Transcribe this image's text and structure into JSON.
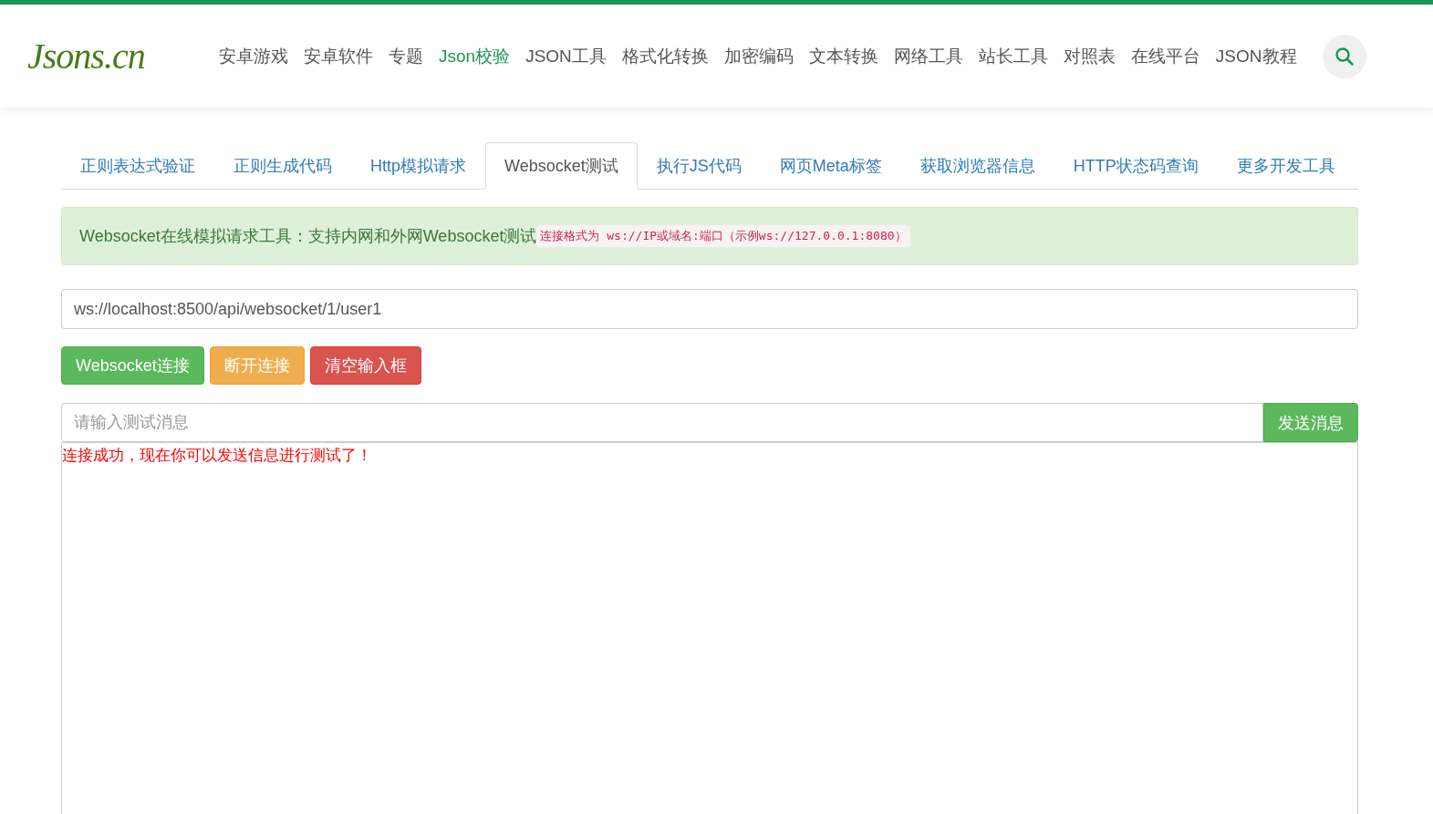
{
  "header": {
    "logo": "Jsons.cn",
    "nav": [
      {
        "label": "安卓游戏",
        "selected": false
      },
      {
        "label": "安卓软件",
        "selected": false
      },
      {
        "label": "专题",
        "selected": false
      },
      {
        "label": "Json校验",
        "selected": true
      },
      {
        "label": "JSON工具",
        "selected": false
      },
      {
        "label": "格式化转换",
        "selected": false
      },
      {
        "label": "加密编码",
        "selected": false
      },
      {
        "label": "文本转换",
        "selected": false
      },
      {
        "label": "网络工具",
        "selected": false
      },
      {
        "label": "站长工具",
        "selected": false
      },
      {
        "label": "对照表",
        "selected": false
      },
      {
        "label": "在线平台",
        "selected": false
      },
      {
        "label": "JSON教程",
        "selected": false
      }
    ]
  },
  "tabs": [
    {
      "label": "正则表达式验证",
      "selected": false
    },
    {
      "label": "正则生成代码",
      "selected": false
    },
    {
      "label": "Http模拟请求",
      "selected": false
    },
    {
      "label": "Websocket测试",
      "selected": true
    },
    {
      "label": "执行JS代码",
      "selected": false
    },
    {
      "label": "网页Meta标签",
      "selected": false
    },
    {
      "label": "获取浏览器信息",
      "selected": false
    },
    {
      "label": "HTTP状态码查询",
      "selected": false
    },
    {
      "label": "更多开发工具",
      "selected": false
    }
  ],
  "notice": {
    "text": "Websocket在线模拟请求工具：支持内网和外网Websocket测试",
    "code": "连接格式为 ws://IP或域名:端口（示例ws://127.0.0.1:8080）"
  },
  "url_field": {
    "value": "ws://localhost:8500/api/websocket/1/user1"
  },
  "buttons": [
    {
      "label": "Websocket连接",
      "kind": "success"
    },
    {
      "label": "断开连接",
      "kind": "warning"
    },
    {
      "label": "清空输入框",
      "kind": "danger"
    }
  ],
  "message": {
    "placeholder": "请输入测试消息",
    "send": "发送消息"
  },
  "log": [
    "连接成功，现在你可以发送信息进行测试了！"
  ]
}
